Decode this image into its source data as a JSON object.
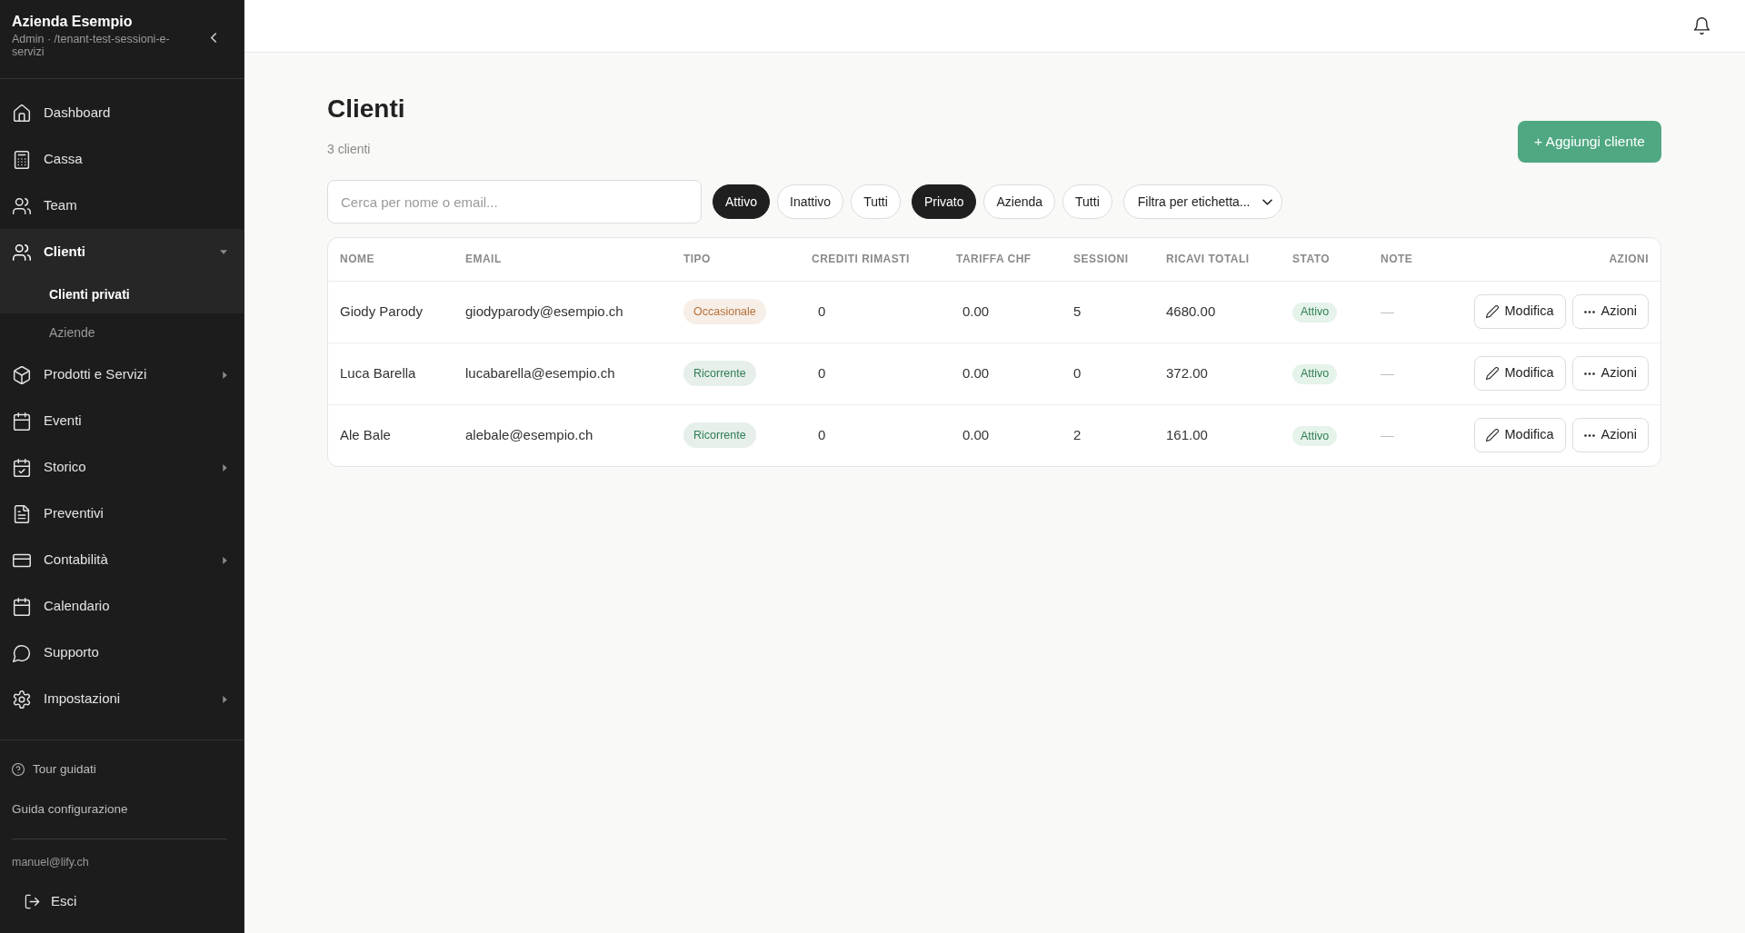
{
  "sidebar": {
    "title": "Azienda Esempio",
    "subtitle": "Admin · /tenant-test-sessioni-e-servizi",
    "items": [
      {
        "label": "Dashboard",
        "kind": "link",
        "selected": false
      },
      {
        "label": "Cassa",
        "kind": "link",
        "selected": false
      },
      {
        "label": "Team",
        "kind": "link",
        "selected": false
      },
      {
        "label": "Clienti",
        "kind": "group",
        "selected": true,
        "expanded": true,
        "children": [
          {
            "label": "Clienti privati",
            "selected": true
          },
          {
            "label": "Aziende",
            "selected": false
          }
        ]
      },
      {
        "label": "Prodotti e Servizi",
        "kind": "group",
        "selected": false,
        "expanded": false
      },
      {
        "label": "Eventi",
        "kind": "link",
        "selected": false
      },
      {
        "label": "Storico",
        "kind": "group",
        "selected": false,
        "expanded": false
      },
      {
        "label": "Preventivi",
        "kind": "link",
        "selected": false
      },
      {
        "label": "Contabilità",
        "kind": "group",
        "selected": false,
        "expanded": false
      },
      {
        "label": "Calendario",
        "kind": "link",
        "selected": false
      },
      {
        "label": "Supporto",
        "kind": "link",
        "selected": false
      },
      {
        "label": "Impostazioni",
        "kind": "group",
        "selected": false,
        "expanded": false
      }
    ],
    "tour_link": "Tour guidati",
    "setup_link": "Guida configurazione",
    "user_email": "manuel@lify.ch",
    "logout": "Esci"
  },
  "page": {
    "title": "Clienti",
    "count": "3 clienti",
    "add_button": "+ Aggiungi cliente"
  },
  "filters": {
    "search": {
      "placeholder": "Cerca per nome o email..."
    },
    "status_filters": [
      {
        "label": "Attivo",
        "selected": true
      },
      {
        "label": "Inattivo",
        "selected": false
      },
      {
        "label": "Tutti",
        "selected": false
      }
    ],
    "type_filters": [
      {
        "label": "Privato",
        "selected": true
      },
      {
        "label": "Azienda",
        "selected": false
      },
      {
        "label": "Tutti",
        "selected": false
      }
    ],
    "tag_filter": "Filtra per etichetta..."
  },
  "table": {
    "columns": [
      "NOME",
      "EMAIL",
      "TIPO",
      "CREDITI RIMASTI",
      "TARIFFA CHF",
      "SESSIONI",
      "RICAVI TOTALI",
      "STATO",
      "NOTE",
      "AZIONI"
    ],
    "rows": [
      {
        "name": "Giody Parody",
        "email": "giodyparody@esempio.ch",
        "type": {
          "label": "Occasionale",
          "color": "#b5703a"
        },
        "credits": "0",
        "rate": "0.00",
        "sessions": "5",
        "revenue": "4680.00",
        "status": "Attivo",
        "note": "—",
        "edit_button": "Modifica",
        "more_button": "Azioni"
      },
      {
        "name": "Luca Barella",
        "email": "lucabarella@esempio.ch",
        "type": {
          "label": "Ricorrente",
          "color": "#2f7d53"
        },
        "credits": "0",
        "rate": "0.00",
        "sessions": "0",
        "revenue": "372.00",
        "status": "Attivo",
        "note": "—",
        "edit_button": "Modifica",
        "more_button": "Azioni"
      },
      {
        "name": "Ale Bale",
        "email": "alebale@esempio.ch",
        "type": {
          "label": "Ricorrente",
          "color": "#2f7d53"
        },
        "credits": "0",
        "rate": "0.00",
        "sessions": "2",
        "revenue": "161.00",
        "status": "Attivo",
        "note": "—",
        "edit_button": "Modifica",
        "more_button": "Azioni"
      }
    ]
  }
}
